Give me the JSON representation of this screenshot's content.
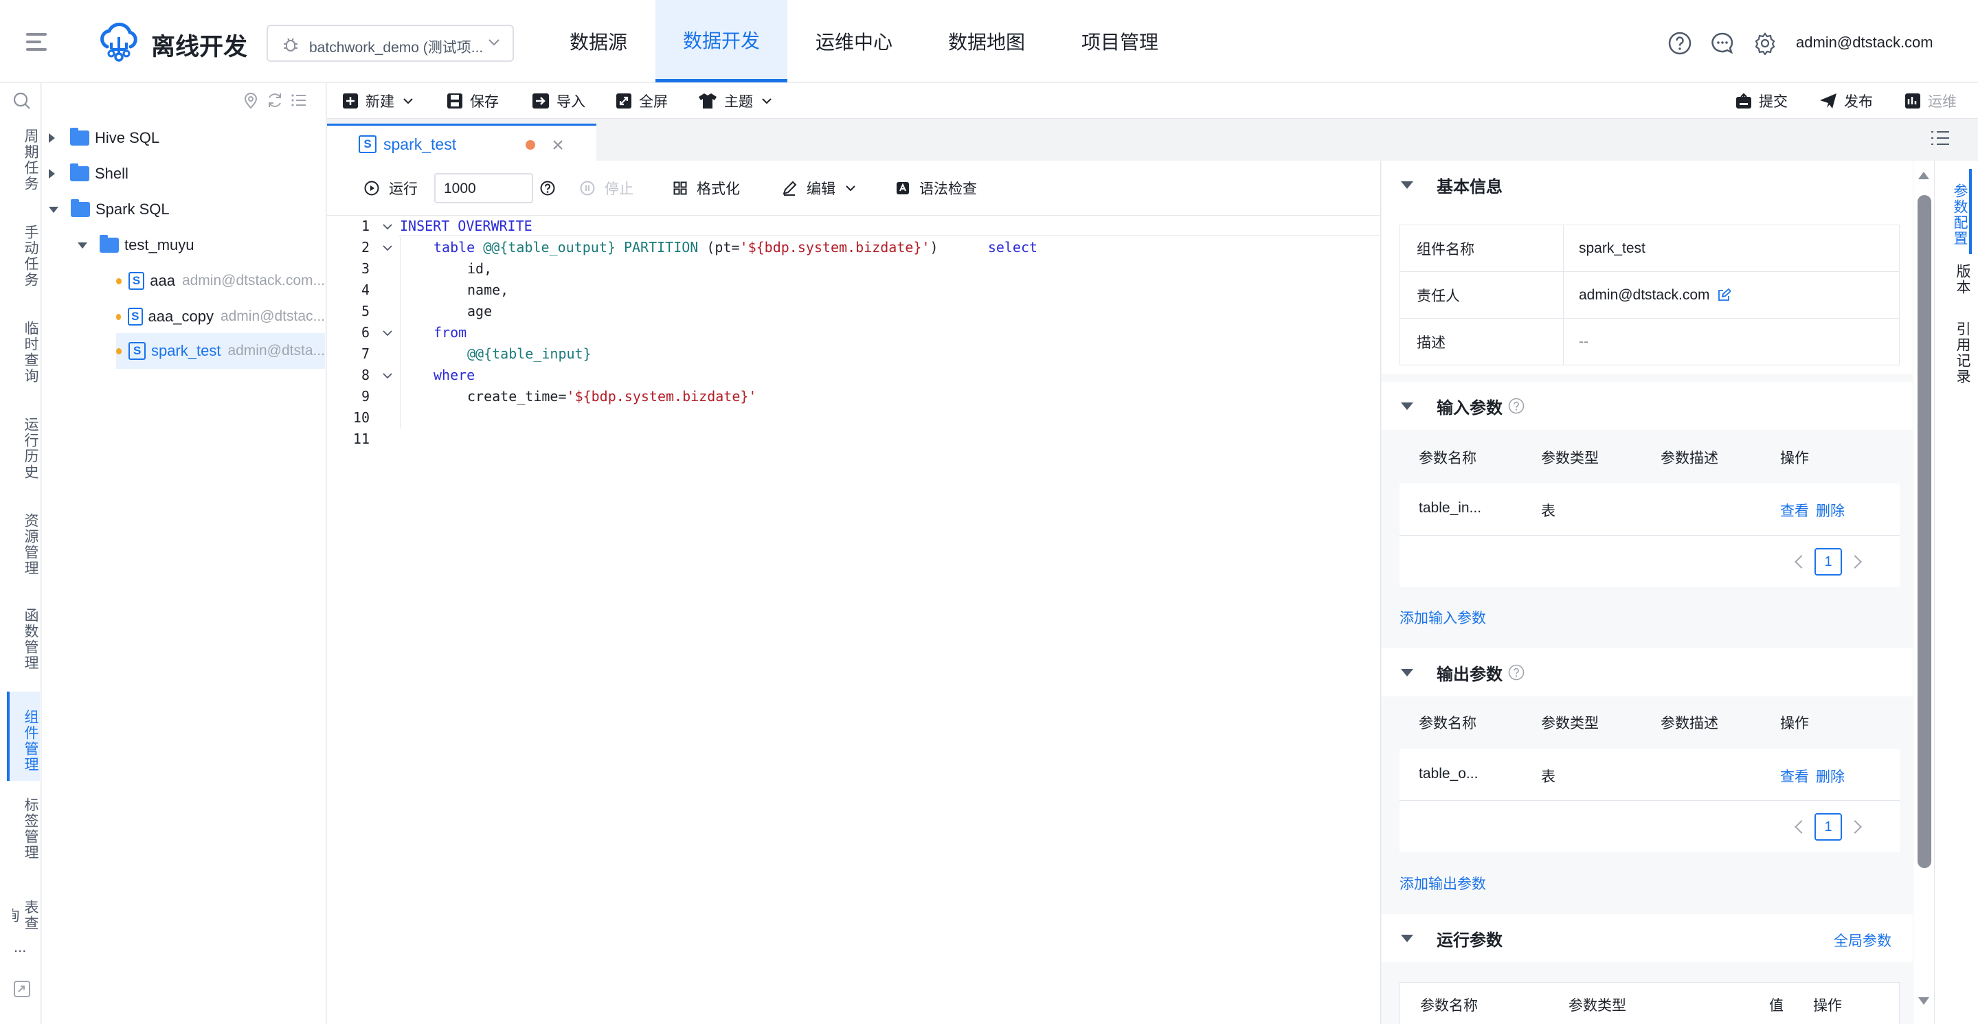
{
  "header": {
    "app_title": "离线开发",
    "project_selector": "batchwork_demo (测试项...",
    "nav": [
      "数据源",
      "数据开发",
      "运维中心",
      "数据地图",
      "项目管理"
    ],
    "active_nav": "数据开发",
    "user": "admin@dtstack.com",
    "icons": [
      "help-icon",
      "message-icon",
      "settings-icon"
    ]
  },
  "activity_bar": {
    "items": [
      "周期任务",
      "手动任务",
      "临时查询",
      "运行历史",
      "资源管理",
      "函数管理",
      "组件管理",
      "标签管理",
      "表查询"
    ],
    "active": "组件管理",
    "more": "..."
  },
  "tree": {
    "folders": [
      "Hive SQL",
      "Shell",
      "Spark SQL"
    ],
    "subfolder": "test_muyu",
    "files": [
      {
        "name": "aaa",
        "owner": "admin@dtstack.com..."
      },
      {
        "name": "aaa_copy",
        "owner": "admin@dtstac..."
      },
      {
        "name": "spark_test",
        "owner": "admin@dtsta..."
      }
    ]
  },
  "toolbar": {
    "left": [
      "新建",
      "保存",
      "导入",
      "全屏",
      "主题"
    ],
    "right": [
      "提交",
      "发布",
      "运维"
    ]
  },
  "tab": {
    "label": "spark_test"
  },
  "editor": {
    "tools": {
      "run": "运行",
      "limit": "1000",
      "stop": "停止",
      "format": "格式化",
      "edit": "编辑",
      "syntax": "语法检查"
    },
    "line_numbers": [
      "1",
      "2",
      "3",
      "4",
      "5",
      "6",
      "7",
      "8",
      "9",
      "10",
      "11"
    ],
    "lines": {
      "l1": "INSERT OVERWRITE",
      "l2_kw": "table",
      "l2_var": "@@{table_output}",
      "l2_part": "PARTITION",
      "l2_open": "(pt=",
      "l2_str": "'${bdp.system.bizdate}'",
      "l2_close": ")",
      "l2_select": "select",
      "l3": "id,",
      "l4": "name,",
      "l5": "age",
      "l6": "from",
      "l7": "@@{table_input}",
      "l8": "where",
      "l9_a": "create_time=",
      "l9_str": "'${bdp.system.bizdate}'"
    }
  },
  "right_panel": {
    "basic": {
      "title": "基本信息",
      "rows": [
        {
          "k": "组件名称",
          "v": "spark_test"
        },
        {
          "k": "责任人",
          "v": "admin@dtstack.com"
        },
        {
          "k": "描述",
          "v": "--"
        }
      ]
    },
    "input": {
      "title": "输入参数",
      "headers": [
        "参数名称",
        "参数类型",
        "参数描述",
        "操作"
      ],
      "row": {
        "name": "table_in...",
        "type": "表",
        "view": "查看",
        "delete": "删除"
      },
      "page": "1",
      "add": "添加输入参数"
    },
    "output": {
      "title": "输出参数",
      "headers": [
        "参数名称",
        "参数类型",
        "参数描述",
        "操作"
      ],
      "row": {
        "name": "table_o...",
        "type": "表",
        "view": "查看",
        "delete": "删除"
      },
      "page": "1",
      "add": "添加输出参数"
    },
    "run": {
      "title": "运行参数",
      "global": "全局参数",
      "headers": [
        "参数名称",
        "参数类型",
        "值",
        "操作"
      ]
    }
  },
  "side_tabs": [
    "参数配置",
    "版本",
    "引用记录"
  ],
  "colors": {
    "accent": "#1a73e8",
    "active_bg": "#e8f2ff",
    "modified_dot": "#f08a5d",
    "tree_dot": "#f5a623"
  }
}
